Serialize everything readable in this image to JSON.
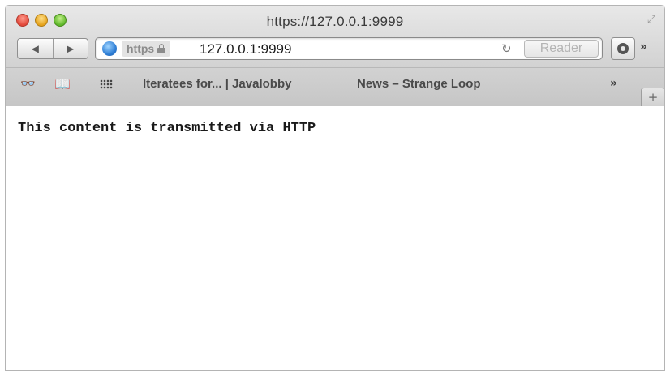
{
  "window": {
    "title": "https://127.0.0.1:9999",
    "fullscreen_glyph": "⤢"
  },
  "toolbar": {
    "back_glyph": "◀",
    "forward_glyph": "▶",
    "address": {
      "scheme_badge": "https",
      "url": "127.0.0.1:9999",
      "reload_glyph": "↻"
    },
    "reader_label": "Reader",
    "overflow_glyph": "»"
  },
  "bookmarks": {
    "reading_list_glyph": "👓",
    "bookmarks_glyph": "📖",
    "links": [
      {
        "label": "Iteratees for... | Javalobby"
      },
      {
        "label": "News – Strange Loop"
      }
    ],
    "overflow_glyph": "»",
    "new_tab_glyph": "+"
  },
  "page": {
    "text": "This content is transmitted via HTTP"
  },
  "icons": {
    "close": "close-button-red",
    "minimize": "minimize-button-yellow",
    "zoom": "zoom-button-green",
    "site": "globe-icon",
    "lock": "lock-icon",
    "downloads": "downloads-icon",
    "top_sites": "grid-icon"
  },
  "colors": {
    "chrome_top": "#e8e8e8",
    "chrome_bottom": "#c6c6c6",
    "close": "#e2483a",
    "minimize": "#e5a21b",
    "zoom": "#5fb82a",
    "globe": "#2f7fd6",
    "page_background": "#ffffff",
    "page_text": "#1a1a1a"
  }
}
